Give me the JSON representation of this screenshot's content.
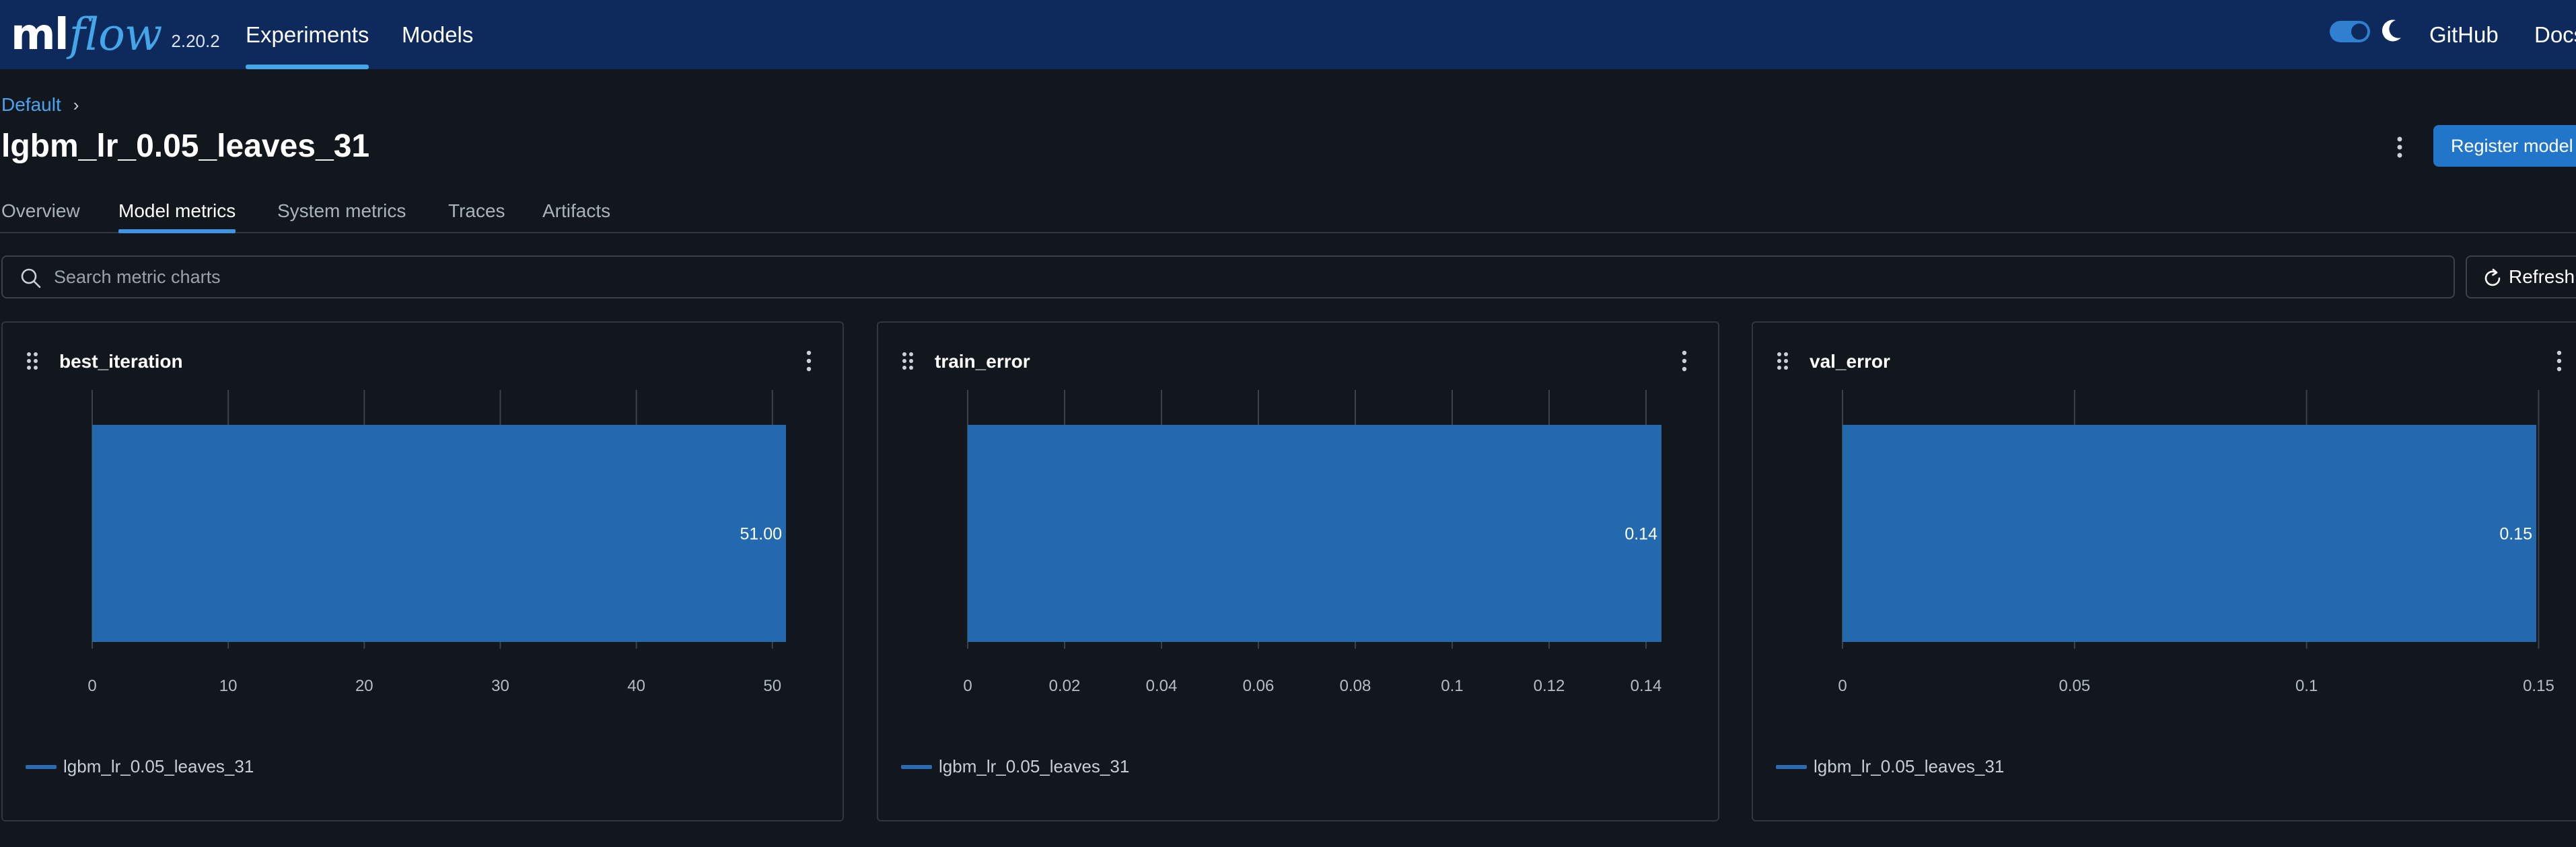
{
  "header": {
    "logo_ml": "ml",
    "logo_flow": "flow",
    "version": "2.20.2",
    "nav": {
      "experiments": "Experiments",
      "models": "Models",
      "github": "GitHub",
      "docs": "Docs"
    }
  },
  "breadcrumb": {
    "parent": "Default",
    "separator": "›"
  },
  "run": {
    "title": "lgbm_lr_0.05_leaves_31",
    "register_label": "Register model"
  },
  "tabs": [
    {
      "label": "Overview",
      "active": false
    },
    {
      "label": "Model metrics",
      "active": true
    },
    {
      "label": "System metrics",
      "active": false
    },
    {
      "label": "Traces",
      "active": false
    },
    {
      "label": "Artifacts",
      "active": false
    }
  ],
  "search": {
    "placeholder": "Search metric charts",
    "value": ""
  },
  "refresh_label": "Refresh",
  "colors": {
    "header_bg": "#0e2a5c",
    "accent": "#43a6e9",
    "bar": "#2369ad",
    "button": "#2276c9"
  },
  "chart_data": [
    {
      "type": "bar",
      "title": "best_iteration",
      "orientation": "horizontal",
      "series": [
        {
          "name": "lgbm_lr_0.05_leaves_31",
          "values": [
            51.0
          ]
        }
      ],
      "data_label": "51.00",
      "xticks": [
        "0",
        "10",
        "20",
        "30",
        "40",
        "50"
      ],
      "xticks_values": [
        0,
        10,
        20,
        30,
        40,
        50
      ],
      "xlim": [
        0,
        51
      ],
      "grid": true,
      "legend": [
        "lgbm_lr_0.05_leaves_31"
      ],
      "legend_position": "bottom-left"
    },
    {
      "type": "bar",
      "title": "train_error",
      "orientation": "horizontal",
      "series": [
        {
          "name": "lgbm_lr_0.05_leaves_31",
          "values": [
            0.1432
          ]
        }
      ],
      "data_label": "0.14",
      "xticks": [
        "0",
        "0.02",
        "0.04",
        "0.06",
        "0.08",
        "0.1",
        "0.12",
        "0.14"
      ],
      "xticks_values": [
        0,
        0.02,
        0.04,
        0.06,
        0.08,
        0.1,
        0.12,
        0.14
      ],
      "xlim": [
        0,
        0.1432
      ],
      "grid": true,
      "legend": [
        "lgbm_lr_0.05_leaves_31"
      ],
      "legend_position": "bottom-left"
    },
    {
      "type": "bar",
      "title": "val_error",
      "orientation": "horizontal",
      "series": [
        {
          "name": "lgbm_lr_0.05_leaves_31",
          "values": [
            0.1495
          ]
        }
      ],
      "data_label": "0.15",
      "xticks": [
        "0",
        "0.05",
        "0.1",
        "0.15"
      ],
      "xticks_values": [
        0,
        0.05,
        0.1,
        0.15
      ],
      "xlim": [
        0,
        0.1495
      ],
      "grid": true,
      "legend": [
        "lgbm_lr_0.05_leaves_31"
      ],
      "legend_position": "bottom-left"
    }
  ]
}
